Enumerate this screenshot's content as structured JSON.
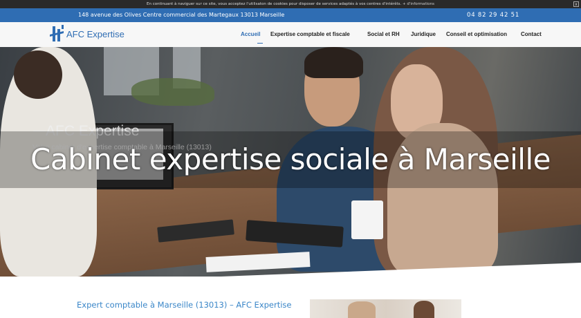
{
  "cookie_bar": {
    "text": "En continuant à naviguer sur ce site, vous acceptez l'utilisaton de cookies pour disposer de services adaptés à vos centres d'intérêts.",
    "more": "+ d'informations",
    "close": "x"
  },
  "topbar": {
    "address": "148 avenue des Olives Centre commercial des Martegaux 13013 Marseille",
    "phone": "04 82 29 42 51"
  },
  "header": {
    "logo_text": "AFC Expertise",
    "nav": [
      "Accueil",
      "Expertise comptable et fiscale",
      "Social et RH",
      "Juridique",
      "Conseil et optimisation",
      "Contact"
    ],
    "active_color": "#2f6db3"
  },
  "hero": {
    "brand": "AFC Expertise",
    "subtitle": "Votre cabinet d'expertise comptable à Marseille (13013)",
    "overlay_title": "Cabinet expertise sociale à Marseille"
  },
  "content": {
    "section_link": "Expert comptable à Marseille (13013) – AFC Expertise"
  },
  "colors": {
    "brand_blue": "#2f6db3",
    "link_blue": "#3a86c8"
  }
}
